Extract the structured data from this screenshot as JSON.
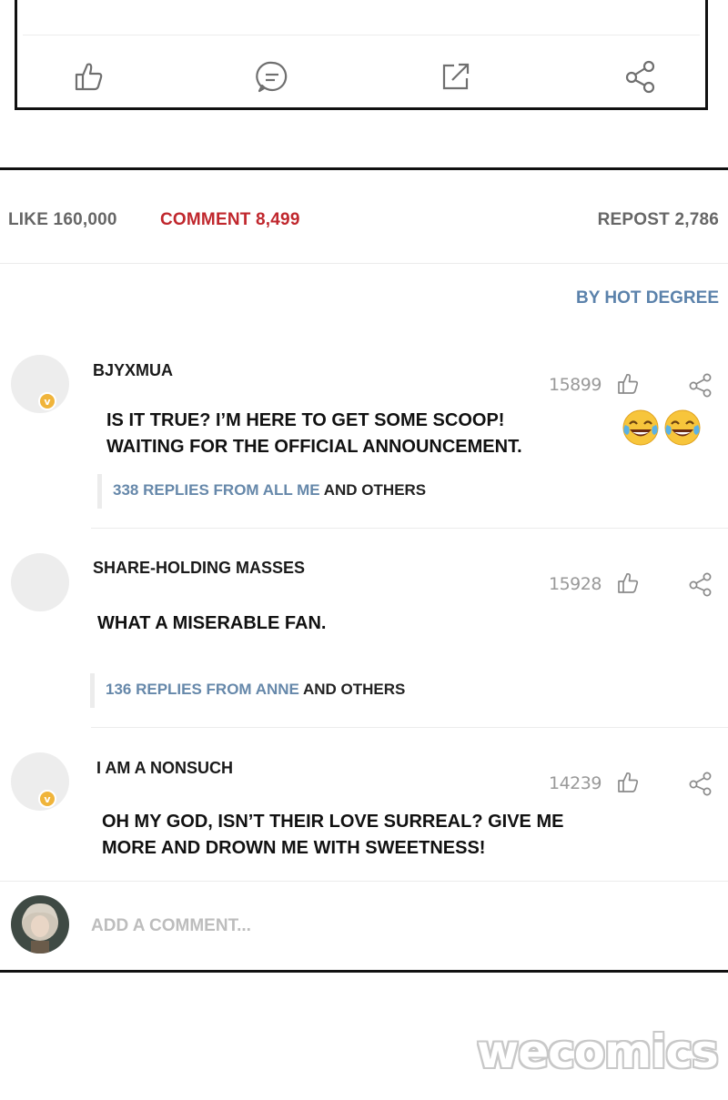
{
  "colors": {
    "accent_red": "#c0272d",
    "link_blue": "#5b82ab",
    "badge_gold": "#f0b43a"
  },
  "top_actions": [
    "like-icon",
    "comment-icon",
    "repost-icon",
    "share-icon"
  ],
  "stats": {
    "like": "LIKE 160,000",
    "comment": "COMMENT 8,499",
    "repost": "REPOST 2,786"
  },
  "sort_label": "BY HOT DEGREE",
  "comments": [
    {
      "username": "BJYXMUA",
      "verified": true,
      "likes": "15899",
      "text_lines": [
        "IS IT TRUE? I’M HERE TO GET SOME SCOOP!",
        "WAITING FOR THE OFFICIAL ANNOUNCEMENT."
      ],
      "emoji": "tears-of-joy",
      "replies_link": "338 REPLIES FROM ALL ME",
      "replies_suffix": "AND OTHERS"
    },
    {
      "username": "SHARE-HOLDING MASSES",
      "verified": false,
      "likes": "15928",
      "text_lines": [
        "WHAT A MISERABLE FAN."
      ],
      "replies_link": "136 REPLIES FROM ANNE",
      "replies_suffix": "AND OTHERS"
    },
    {
      "username": "I AM A NONSUCH",
      "verified": true,
      "likes": "14239",
      "text_lines": [
        "OH MY GOD, ISN’T THEIR LOVE SURREAL? GIVE ME",
        "MORE AND DROWN ME WITH SWEETNESS!"
      ]
    }
  ],
  "composer_placeholder": "ADD A COMMENT...",
  "watermark": "wecomics"
}
